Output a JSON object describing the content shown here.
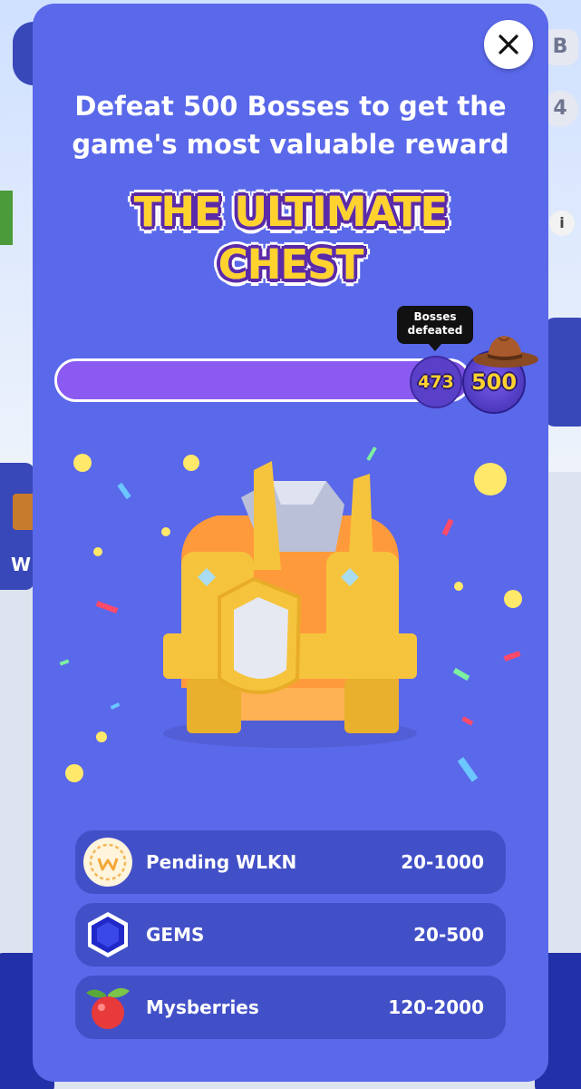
{
  "modal": {
    "headline": "Defeat 500 Bosses to get the game's most valuable reward",
    "title_line1": "THE ULTIMATE",
    "title_line2": "CHEST",
    "close_icon": "close-icon"
  },
  "progress": {
    "tooltip_line1": "Bosses",
    "tooltip_line2": "defeated",
    "current": "473",
    "goal": "500",
    "fraction": 0.946
  },
  "rewards": [
    {
      "name": "Pending WLKN",
      "range": "20-1000",
      "icon": "wlkn-coin-icon"
    },
    {
      "name": "GEMS",
      "range": "20-500",
      "icon": "gem-icon"
    },
    {
      "name": "Mysberries",
      "range": "120-2000",
      "icon": "berry-icon"
    }
  ],
  "background": {
    "left_label": "W",
    "btn_b": "B",
    "btn_4": "4",
    "info": "i"
  }
}
